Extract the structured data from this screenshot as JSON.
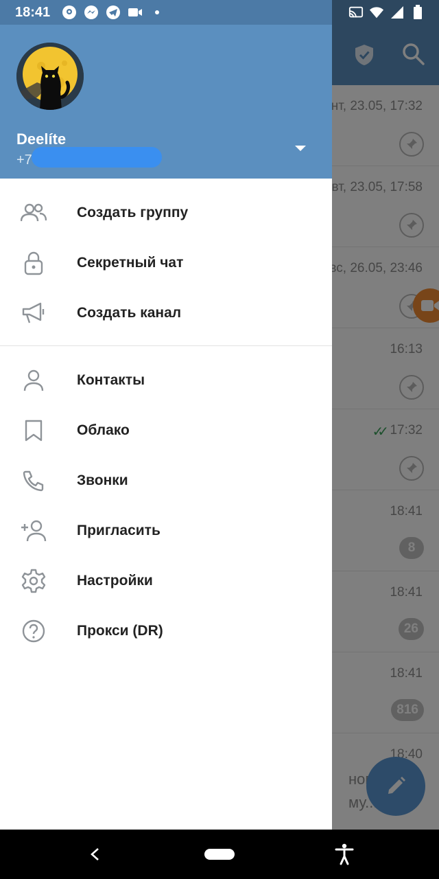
{
  "status_bar": {
    "time": "18:41",
    "left_icons": [
      "location-pin-icon",
      "messenger-icon",
      "telegram-icon",
      "video-camera-icon",
      "dot-icon"
    ],
    "right_icons": [
      "cast-icon",
      "wifi-icon",
      "signal-icon",
      "battery-icon"
    ]
  },
  "drawer": {
    "user": {
      "name": "Deelíte",
      "phone": "+7"
    },
    "menu_primary": [
      {
        "label": "Создать группу",
        "icon": "group-icon"
      },
      {
        "label": "Секретный чат",
        "icon": "lock-icon"
      },
      {
        "label": "Создать канал",
        "icon": "megaphone-icon"
      }
    ],
    "menu_secondary": [
      {
        "label": "Контакты",
        "icon": "person-icon"
      },
      {
        "label": "Облако",
        "icon": "bookmark-icon"
      },
      {
        "label": "Звонки",
        "icon": "phone-icon"
      },
      {
        "label": "Пригласить",
        "icon": "add-person-icon"
      },
      {
        "label": "Настройки",
        "icon": "gear-icon"
      },
      {
        "label": "Прокси (DR)",
        "icon": "help-circle-icon"
      }
    ]
  },
  "background_chats": [
    {
      "time": "нт, 23.05, 17:32",
      "pinned": true
    },
    {
      "time": "вт, 23.05, 17:58",
      "pinned": true
    },
    {
      "time": "вс, 26.05, 23:46",
      "pinned": true
    },
    {
      "time": "16:13",
      "pinned": true
    },
    {
      "time": "17:32",
      "pinned": true,
      "read": true
    },
    {
      "time": "18:41",
      "unread": "8"
    },
    {
      "time": "18:41",
      "unread": "26"
    },
    {
      "time": "18:41",
      "unread": "816"
    },
    {
      "time": "18:40",
      "preview_line1": "новы",
      "preview_line2": "му..."
    }
  ],
  "colors": {
    "header": "#5b8fbf",
    "status_bar": "#4c7aa6",
    "fab": "#5a97d2",
    "video_fab": "#f08a32",
    "read_check": "#3aa05a"
  }
}
